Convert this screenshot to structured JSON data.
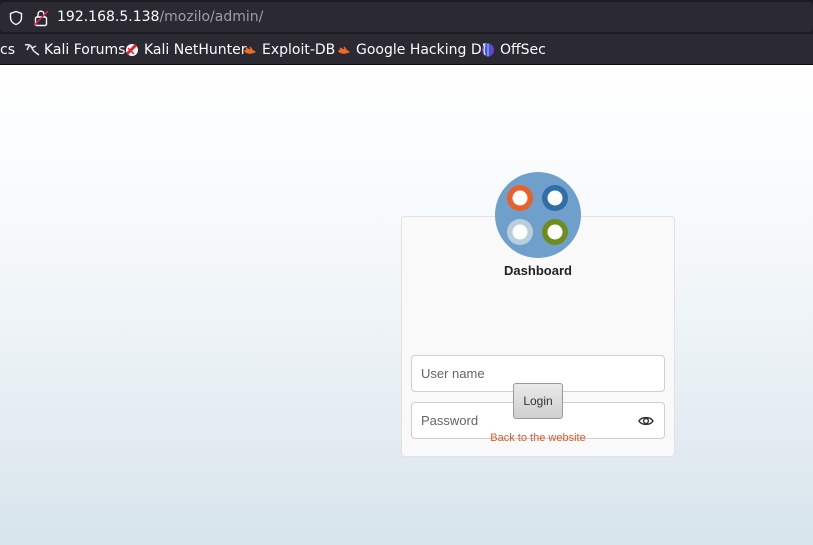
{
  "browser": {
    "url_host": "192.168.5.138",
    "url_path": "/mozilo/admin/",
    "bookmarks": [
      {
        "label": "cs",
        "icon": "none"
      },
      {
        "label": "Kali Forums",
        "icon": "kali-dragon-icon"
      },
      {
        "label": "Kali NetHunter",
        "icon": "nethunter-icon"
      },
      {
        "label": "Exploit-DB",
        "icon": "exploitdb-icon"
      },
      {
        "label": "Google Hacking DB",
        "icon": "ghdb-icon"
      },
      {
        "label": "OffSec",
        "icon": "offsec-icon"
      }
    ]
  },
  "login": {
    "title": "Dashboard",
    "username_placeholder": "User name",
    "password_placeholder": "Password",
    "login_label": "Login",
    "back_link": "Back to the website"
  },
  "colors": {
    "logo_ring": "#6fa0cc",
    "logo_orange": "#e8602c",
    "logo_blue": "#2f6fa6",
    "logo_lightblue": "#b9cfdd",
    "logo_green": "#6f8c1f",
    "link": "#e05a2b"
  }
}
